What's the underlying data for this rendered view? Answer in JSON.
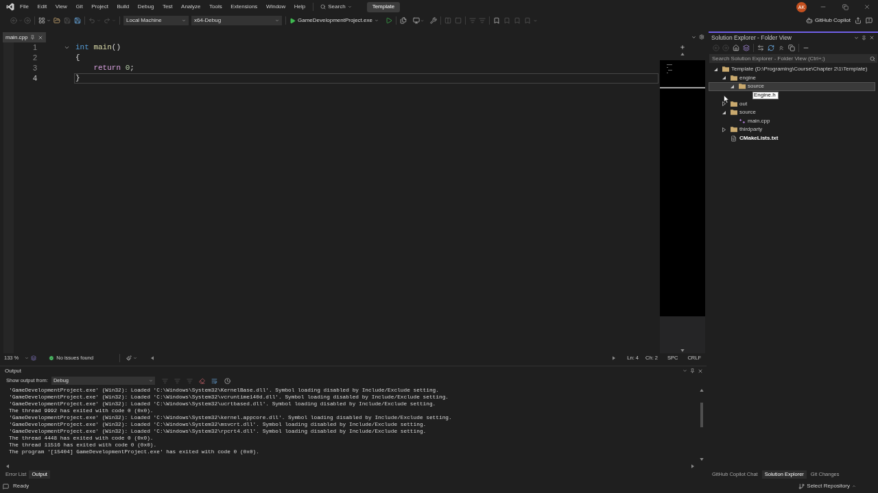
{
  "menu_bar": {
    "items": [
      "File",
      "Edit",
      "View",
      "Git",
      "Project",
      "Build",
      "Debug",
      "Test",
      "Analyze",
      "Tools",
      "Extensions",
      "Window",
      "Help"
    ],
    "search": "Search",
    "solution": "Template",
    "avatar": "AK"
  },
  "toolbar": {
    "target": "Local Machine",
    "configuration": "x64-Debug",
    "startup_item": "GameDevelopmentProject.exe",
    "copilot": "GitHub Copilot"
  },
  "editor": {
    "tabs": [
      {
        "label": "main.cpp",
        "selected": true
      }
    ],
    "lines": [
      {
        "number": "1",
        "fold": true,
        "current": false,
        "tokens": [
          {
            "text": "int ",
            "kind": "keyword"
          },
          {
            "text": "main",
            "kind": "function"
          },
          {
            "text": "()",
            "kind": "plain"
          }
        ]
      },
      {
        "number": "2",
        "fold": false,
        "current": false,
        "tokens": [
          {
            "text": "{",
            "kind": "plain"
          }
        ]
      },
      {
        "number": "3",
        "fold": false,
        "current": false,
        "tokens": [
          {
            "text": "    return ",
            "kind": "control"
          },
          {
            "text": "0",
            "kind": "number"
          },
          {
            "text": ";",
            "kind": "plain"
          }
        ]
      },
      {
        "number": "4",
        "fold": false,
        "current": true,
        "tokens": [
          {
            "text": "}",
            "kind": "plain"
          }
        ]
      }
    ],
    "status": {
      "zoom": "133 %",
      "issues": "No issues found",
      "line": "Ln: 4",
      "column": "Ch: 2",
      "whitespace": "SPC",
      "line_ending": "CRLF"
    }
  },
  "output": {
    "title": "Output",
    "source_label": "Show output from:",
    "source": "Debug",
    "lines": [
      "'GameDevelopmentProject.exe' (Win32): Loaded 'C:\\Windows\\System32\\KernelBase.dll'. Symbol loading disabled by Include/Exclude setting.",
      "'GameDevelopmentProject.exe' (Win32): Loaded 'C:\\Windows\\System32\\vcruntime140d.dll'. Symbol loading disabled by Include/Exclude setting.",
      "'GameDevelopmentProject.exe' (Win32): Loaded 'C:\\Windows\\System32\\ucrtbased.dll'. Symbol loading disabled by Include/Exclude setting.",
      "The thread 9992 has exited with code 0 (0x0).",
      "'GameDevelopmentProject.exe' (Win32): Loaded 'C:\\Windows\\System32\\kernel.appcore.dll'. Symbol loading disabled by Include/Exclude setting.",
      "'GameDevelopmentProject.exe' (Win32): Loaded 'C:\\Windows\\System32\\msvcrt.dll'. Symbol loading disabled by Include/Exclude setting.",
      "'GameDevelopmentProject.exe' (Win32): Loaded 'C:\\Windows\\System32\\rpcrt4.dll'. Symbol loading disabled by Include/Exclude setting.",
      "The thread 4448 has exited with code 0 (0x0).",
      "The thread 11516 has exited with code 0 (0x0).",
      "The program '[15404] GameDevelopmentProject.exe' has exited with code 0 (0x0)."
    ]
  },
  "bottom_tabs": [
    {
      "label": "Error List",
      "selected": false
    },
    {
      "label": "Output",
      "selected": true
    }
  ],
  "solution_explorer": {
    "title": "Solution Explorer - Folder View",
    "search": {
      "placeholder": "Search Solution Explorer - Folder View (Ctrl+;)"
    },
    "tree": [
      {
        "kind": "folder",
        "label": "Template (D:\\Programing\\Course\\Chapter 2\\1\\Template)",
        "expanded": true,
        "selected": false,
        "startup": false,
        "children": [
          {
            "kind": "folder",
            "label": "engine",
            "expanded": true,
            "selected": false,
            "startup": false,
            "children": [
              {
                "kind": "folder",
                "label": "source",
                "expanded": true,
                "selected": true,
                "startup": false,
                "children": [
                  {
                    "kind": "rename",
                    "value": "Engine.h",
                    "selected": false
                  }
                ]
              }
            ]
          },
          {
            "kind": "folder",
            "label": "out",
            "expanded": false,
            "selected": false,
            "startup": false
          },
          {
            "kind": "folder",
            "label": "source",
            "expanded": true,
            "selected": false,
            "startup": false,
            "children": [
              {
                "kind": "cpp",
                "label": "main.cpp",
                "selected": false,
                "startup": false
              }
            ]
          },
          {
            "kind": "folder",
            "label": "thirdparty",
            "expanded": false,
            "selected": false,
            "startup": false
          },
          {
            "kind": "cmake",
            "label": "CMakeLists.txt",
            "selected": false,
            "startup": true
          }
        ]
      }
    ],
    "tabs": [
      {
        "label": "GitHub Copilot Chat",
        "selected": false
      },
      {
        "label": "Solution Explorer",
        "selected": true
      },
      {
        "label": "Git Changes",
        "selected": false
      }
    ]
  },
  "status_bar": {
    "text": "Ready",
    "repository": "Select Repository"
  }
}
